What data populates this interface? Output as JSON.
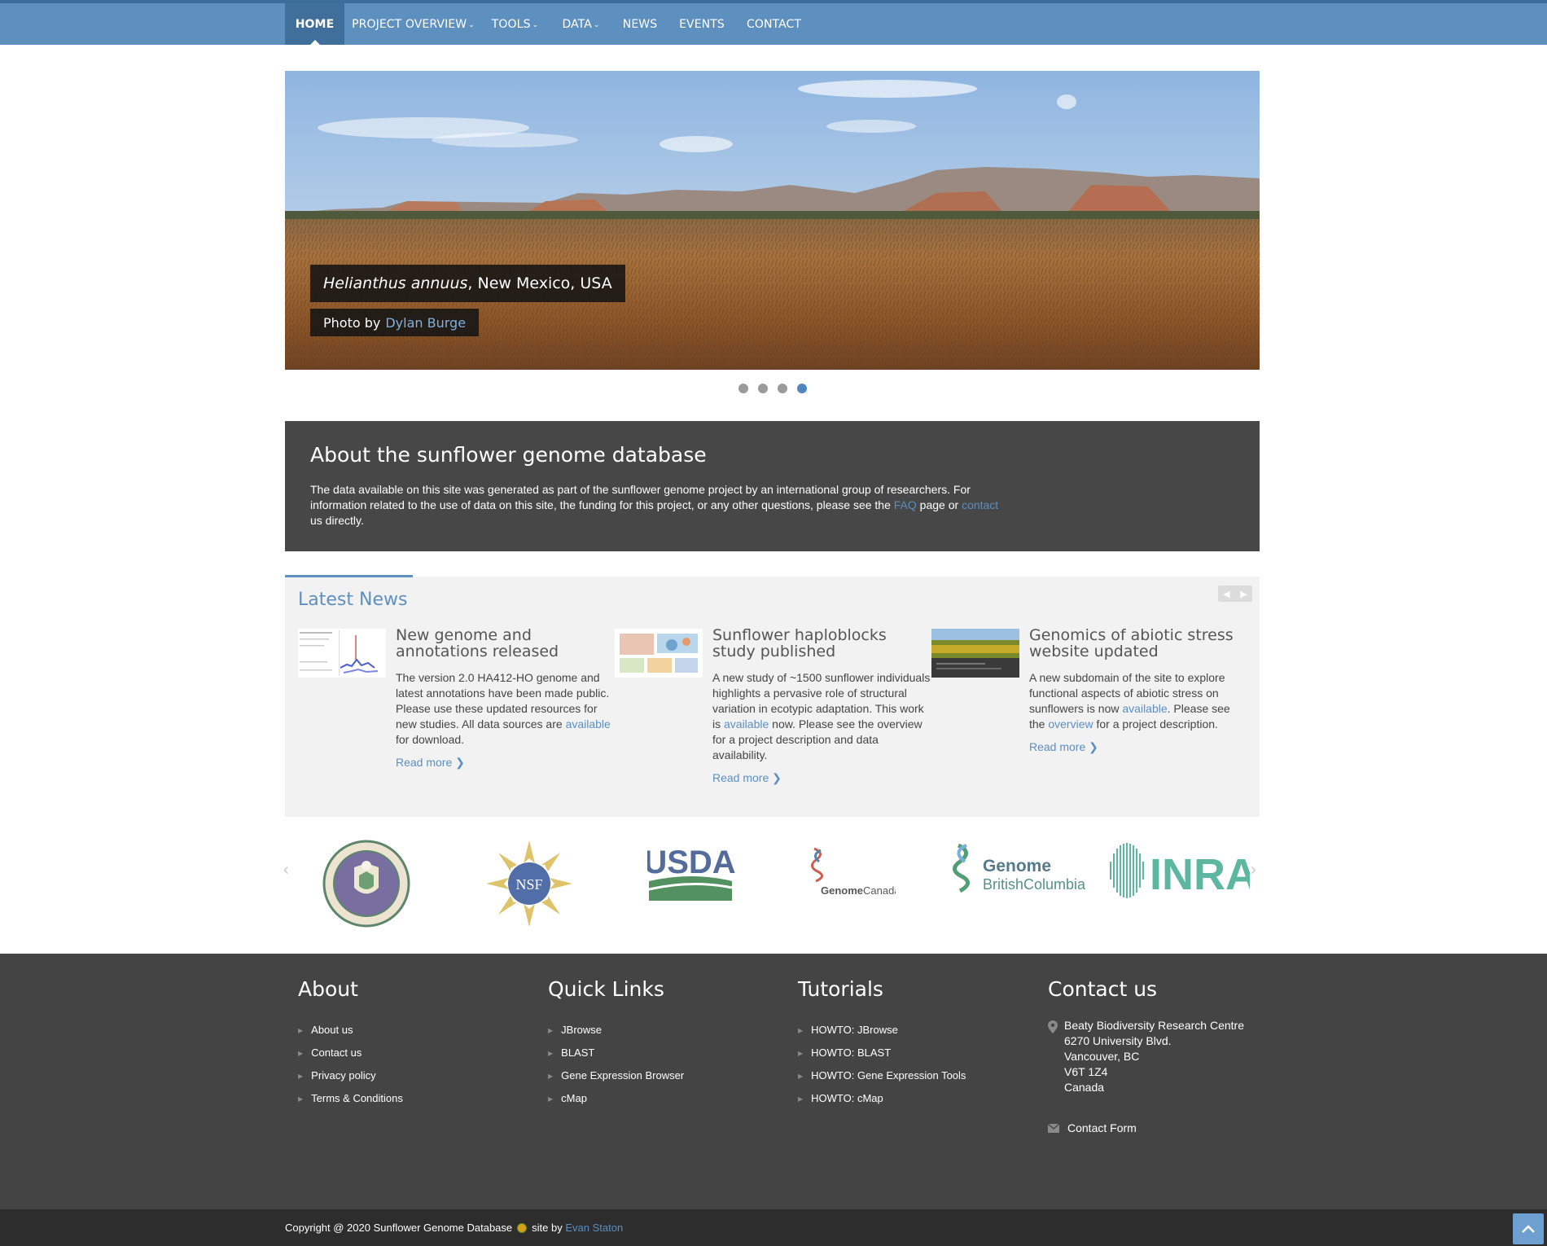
{
  "nav": {
    "items": [
      {
        "label": "HOME",
        "active": true
      },
      {
        "label": "PROJECT OVERVIEW",
        "dropdown": true
      },
      {
        "label": "TOOLS",
        "dropdown": true
      },
      {
        "label": "DATA",
        "dropdown": true
      },
      {
        "label": "NEWS"
      },
      {
        "label": "EVENTS"
      },
      {
        "label": "CONTACT"
      }
    ]
  },
  "hero": {
    "caption_italic": "Helianthus annuus",
    "caption_rest": ", New Mexico, USA",
    "photo_prefix": "Photo by",
    "photographer": "Dylan Burge",
    "slides": 4,
    "active_slide": 4
  },
  "about": {
    "title": "About the sunflower genome database",
    "text_1": "The data available on this site was generated as part of the sunflower genome project by an international group of researchers. For information related to the use of data on this site, the funding for this project, or any other questions, please see the ",
    "link_faq": "FAQ",
    "text_2": " page or ",
    "link_contact": "contact",
    "text_3": " us directly."
  },
  "news": {
    "title": "Latest News",
    "items": [
      {
        "title": "New genome and annotations released",
        "body_1": "The version 2.0 HA412-HO genome and latest annotations have been made public. Please use these updated resources for new studies. All data sources are ",
        "link": "available",
        "body_2": " for download.",
        "read_more": "Read more"
      },
      {
        "title": "Sunflower haploblocks study published",
        "body_1": "A new study of ~1500 sunflower individuals highlights a pervasive role of structural variation in ecotypic adaptation. This work is ",
        "link": "available",
        "body_2": " now. Please see the overview for a project description and data availability.",
        "read_more": "Read more"
      },
      {
        "title": "Genomics of abiotic stress website updated",
        "body_1": "A new subdomain of the site to explore functional aspects of abiotic stress on sunflowers is now ",
        "link": "available",
        "body_2": ". Please see the ",
        "link2": "overview",
        "body_3": " for a project description.",
        "read_more": "Read more"
      }
    ]
  },
  "logos": {
    "nsf": "NSF",
    "usda": "USDA",
    "genome_canada_1": "Genome",
    "genome_canada_2": "Canada",
    "gbc_1": "Genome",
    "gbc_2": "BritishColumbia",
    "inra": "INRA"
  },
  "footer": {
    "about": {
      "title": "About",
      "links": [
        "About us",
        "Contact us",
        "Privacy policy",
        "Terms & Conditions"
      ]
    },
    "quick": {
      "title": "Quick Links",
      "links": [
        "JBrowse",
        "BLAST",
        "Gene Expression Browser",
        "cMap"
      ]
    },
    "tutorials": {
      "title": "Tutorials",
      "links": [
        "HOWTO: JBrowse",
        "HOWTO: BLAST",
        "HOWTO: Gene Expression Tools",
        "HOWTO: cMap"
      ]
    },
    "contact": {
      "title": "Contact us",
      "address": [
        "Beaty Biodiversity Research Centre",
        "6270 University Blvd.",
        "Vancouver, BC",
        "V6T 1Z4",
        "Canada"
      ],
      "form_label": "Contact Form"
    }
  },
  "copyright": {
    "text": "Copyright @ 2020 Sunflower Genome Database",
    "site_by": "site by",
    "author": "Evan Staton"
  },
  "colors": {
    "nav": "#5e90bf",
    "nav_active": "#3f6f9a",
    "band": "#474747",
    "footer": "#444444",
    "link": "#5b8fc2"
  }
}
